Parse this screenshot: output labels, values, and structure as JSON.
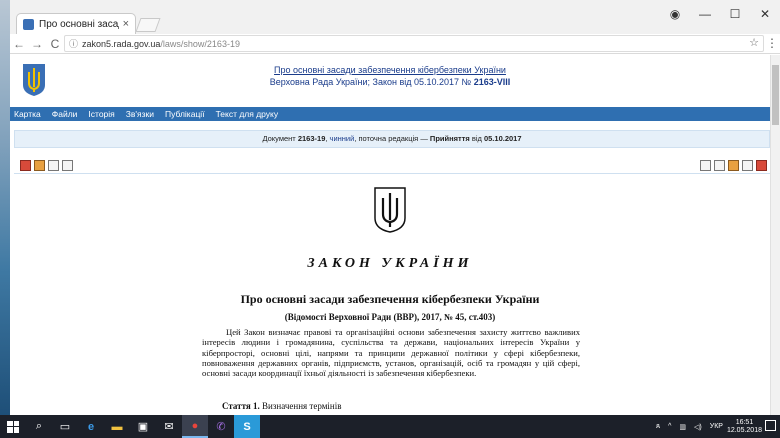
{
  "browser": {
    "tab_title": "Про основні засади забе",
    "tab_close": "×",
    "url_host": "zakon5.rada.gov.ua",
    "url_path": "/laws/show/2163-19",
    "nav_back": "←",
    "nav_forward": "→",
    "nav_reload": "C",
    "star": "☆",
    "menu": "⋮",
    "win_account": "◉",
    "win_min": "—",
    "win_max": "☐",
    "win_close": "✕"
  },
  "site": {
    "header_link": "Про основні засади забезпечення кібербезпеки України",
    "header_sub_prefix": "Верховна Рада України; Закон від 05.10.2017 №",
    "header_sub_number": "2163-VIII",
    "menu": [
      "Картка",
      "Файли",
      "Історія",
      "Зв'язки",
      "Публікації",
      "Текст для друку"
    ],
    "docbar": {
      "prefix": "Документ",
      "number": "2163-19",
      "status": "чинний",
      "middle": ", поточна редакція —",
      "adopt": "Прийняття",
      "from": "від",
      "date": "05.10.2017"
    }
  },
  "document": {
    "law_title": "ЗАКОН УКРАЇНИ",
    "law_name": "Про основні засади забезпечення кібербезпеки України",
    "source": "(Відомості Верховної Ради (ВВР), 2017, № 45, ст.403)",
    "body": "Цей Закон визначає правові та організаційні основи забезпечення захисту життєво важливих інтересів людини і громадянина, суспільства та держави, національних інтересів України у кіберпросторі, основні цілі, напрями та принципи державної політики у сфері кібербезпеки, повноваження державних органів, підприємств, установ, організацій, осіб та громадян у цій сфері, основні засади координації їхньої діяльності із забезпечення кібербезпеки.",
    "article_label": "Стаття 1.",
    "article_title": "Визначення термінів"
  },
  "taskbar": {
    "tray_lang": "УКР",
    "time": "16:51",
    "date": "12.05.2018",
    "tray_user": "ጸ"
  },
  "colors": {
    "menubar": "#2f6fb1",
    "link": "#1a3c8b",
    "docbar_bg": "#e6f0f9"
  }
}
